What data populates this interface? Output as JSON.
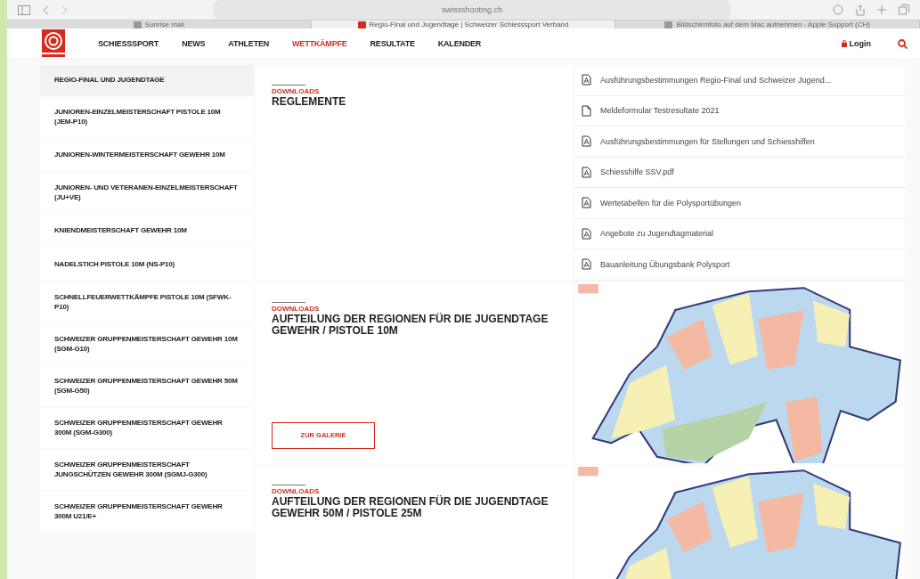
{
  "browser": {
    "url": "swissshooting.ch",
    "tabs": [
      {
        "label": "Sunrise mail",
        "selected": false
      },
      {
        "label": "Regio-Final und Jugendtage | Schweizer Schiesssport Verband",
        "selected": true
      },
      {
        "label": "Bildschirmfoto auf dem Mac aufnehmen - Apple Support (CH)",
        "selected": false
      }
    ]
  },
  "header": {
    "nav": [
      {
        "label": "SCHIESSSPORT",
        "selected": false
      },
      {
        "label": "NEWS",
        "selected": false
      },
      {
        "label": "ATHLETEN",
        "selected": false
      },
      {
        "label": "WETTKÄMPFE",
        "selected": true
      },
      {
        "label": "RESULTATE",
        "selected": false
      },
      {
        "label": "KALENDER",
        "selected": false
      }
    ],
    "login": "Login"
  },
  "sidebar": {
    "items": [
      {
        "label": "REGIO-FINAL UND JUGENDTAGE",
        "selected": true
      },
      {
        "label": "JUNIOREN-EINZELMEISTERSCHAFT PISTOLE 10M (JEM-P10)",
        "selected": false
      },
      {
        "label": "JUNIOREN-WINTERMEISTERSCHAFT GEWEHR 10M",
        "selected": false
      },
      {
        "label": "JUNIOREN- UND VETERANEN-EINZELMEISTERSCHAFT (JU+VE)",
        "selected": false
      },
      {
        "label": "KNIENDMEISTERSCHAFT GEWEHR 10M",
        "selected": false
      },
      {
        "label": "NADELSTICH PISTOLE 10M (NS-P10)",
        "selected": false
      },
      {
        "label": "SCHNELLFEUERWETTKÄMPFE PISTOLE 10M (SFWK-P10)",
        "selected": false
      },
      {
        "label": "SCHWEIZER GRUPPENMEISTERSCHAFT GEWEHR 10M (SGM-G10)",
        "selected": false
      },
      {
        "label": "SCHWEIZER GRUPPENMEISTERSCHAFT GEWEHR 50M (SGM-G50)",
        "selected": false
      },
      {
        "label": "SCHWEIZER GRUPPENMEISTERSCHAFT GEWEHR 300M (SGM-G300)",
        "selected": false
      },
      {
        "label": "SCHWEIZER GRUPPENMEISTERSCHAFT JUNGSCHÜTZEN GEWEHR 300M (SGMJ-G300)",
        "selected": false
      },
      {
        "label": "SCHWEIZER GRUPPENMEISTERSCHAFT GEWEHR 300M U21/E+",
        "selected": false
      }
    ]
  },
  "sections": [
    {
      "kind": "files",
      "eyebrow": "DOWNLOADS",
      "title": "REGLEMENTE",
      "files": [
        {
          "kind": "pdf",
          "name": "Ausführungsbestimmungen Regio-Final und Schweizer Jugend..."
        },
        {
          "kind": "doc",
          "name": "Meldeformular Testresultate 2021"
        },
        {
          "kind": "pdf",
          "name": "Ausführungsbestimmungen für Stellungen und Schiesshilfen"
        },
        {
          "kind": "pdf",
          "name": "Schiesshilfe SSV.pdf"
        },
        {
          "kind": "pdf",
          "name": "Wertetabellen für die Polysportübungen"
        },
        {
          "kind": "pdf",
          "name": "Angebote zu Jugendtagmaterial"
        },
        {
          "kind": "pdf",
          "name": "Bauanleitung Übungsbank Polysport"
        }
      ]
    },
    {
      "kind": "map",
      "eyebrow": "DOWNLOADS",
      "title": "AUFTEILUNG DER REGIONEN FÜR DIE JUGENDTAGE GEWEHR / PISTOLE 10M",
      "button": "ZUR GALERIE"
    },
    {
      "kind": "map",
      "eyebrow": "DOWNLOADS",
      "title": "AUFTEILUNG DER REGIONEN FÜR DIE JUGENDTAGE GEWEHR 50M / PISTOLE 25M"
    }
  ]
}
